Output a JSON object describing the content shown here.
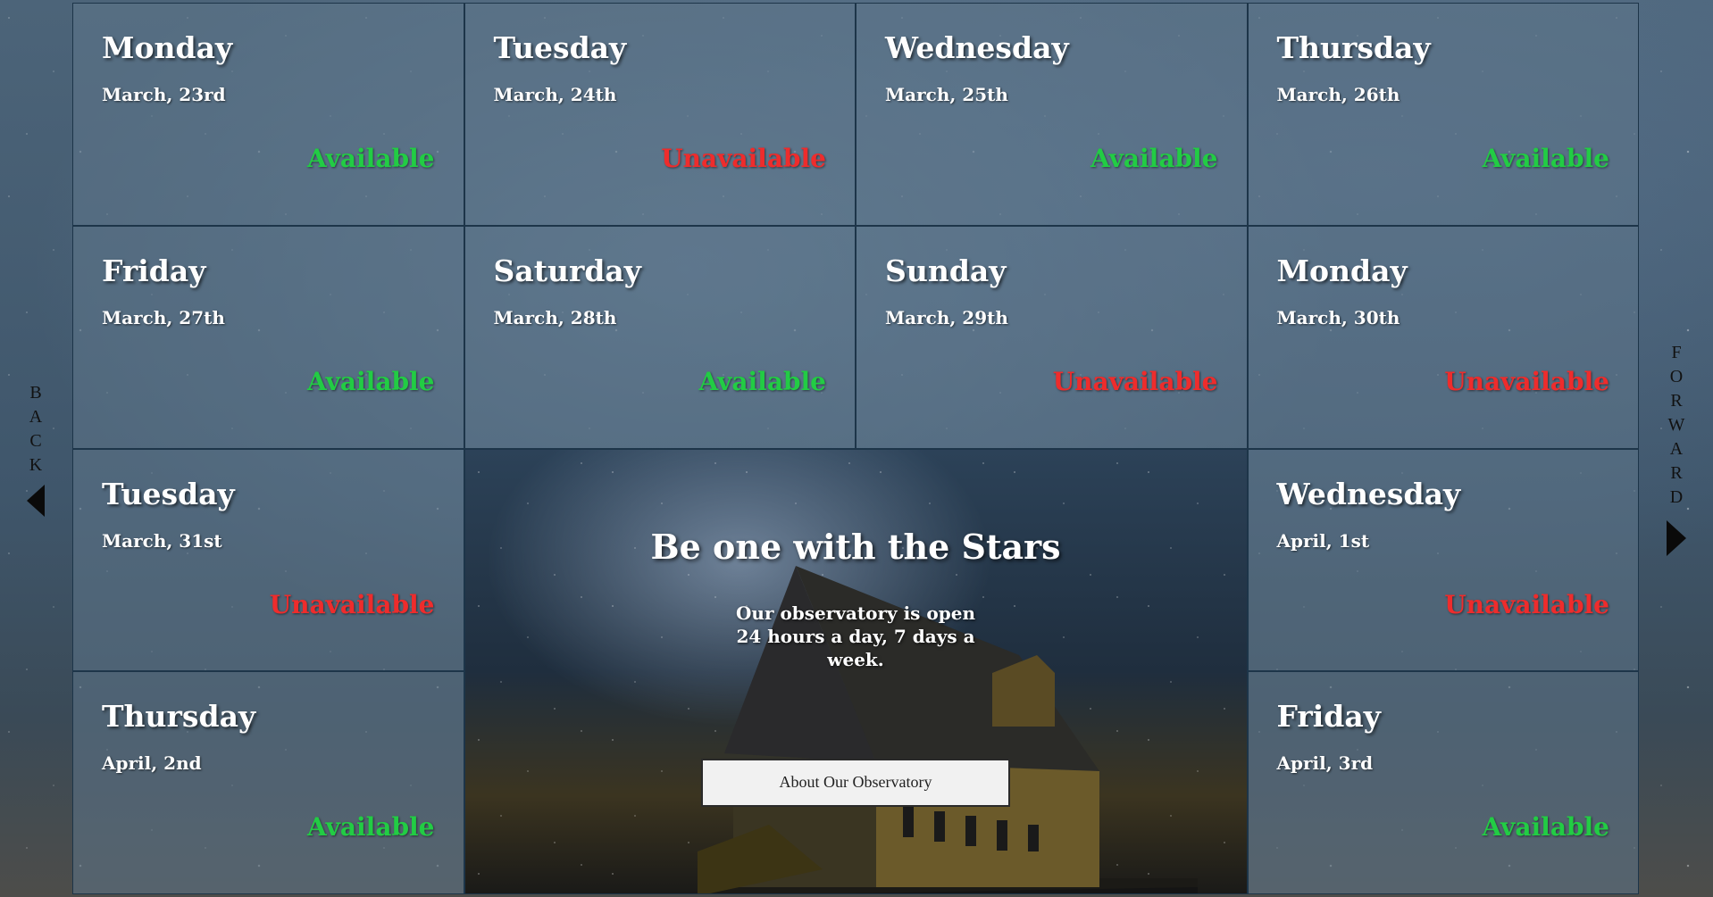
{
  "nav": {
    "back_label": "BACK",
    "forward_label": "FORWARD"
  },
  "days": [
    {
      "day": "Monday",
      "date": "March, 23rd",
      "status": "Available"
    },
    {
      "day": "Tuesday",
      "date": "March, 24th",
      "status": "Unavailable"
    },
    {
      "day": "Wednesday",
      "date": "March, 25th",
      "status": "Available"
    },
    {
      "day": "Thursday",
      "date": "March, 26th",
      "status": "Available"
    },
    {
      "day": "Friday",
      "date": "March, 27th",
      "status": "Available"
    },
    {
      "day": "Saturday",
      "date": "March, 28th",
      "status": "Available"
    },
    {
      "day": "Sunday",
      "date": "March, 29th",
      "status": "Unavailable"
    },
    {
      "day": "Monday",
      "date": "March, 30th",
      "status": "Unavailable"
    },
    {
      "day": "Tuesday",
      "date": "March, 31st",
      "status": "Unavailable"
    },
    {
      "day": "Wednesday",
      "date": "April, 1st",
      "status": "Unavailable"
    },
    {
      "day": "Thursday",
      "date": "April, 2nd",
      "status": "Available"
    },
    {
      "day": "Friday",
      "date": "April, 3rd",
      "status": "Available"
    }
  ],
  "hero": {
    "title": "Be one with the Stars",
    "subtitle": "Our observatory is open 24 hours a day, 7 days a week.",
    "button_label": "About Our Observatory"
  },
  "colors": {
    "available": "#22cc44",
    "unavailable": "#ee2c2c"
  }
}
